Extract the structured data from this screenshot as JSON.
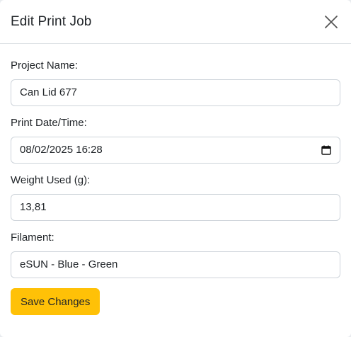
{
  "dialog": {
    "title": "Edit Print Job",
    "close_icon": "close-icon"
  },
  "form": {
    "project_name": {
      "label": "Project Name:",
      "value": "Can Lid 677"
    },
    "print_datetime": {
      "label": "Print Date/Time:",
      "value": "08/02/2025 16:28",
      "icon": "calendar-icon"
    },
    "weight_used": {
      "label": "Weight Used (g):",
      "value": "13,81"
    },
    "filament": {
      "label": "Filament:",
      "value": "eSUN - Blue - Green"
    }
  },
  "actions": {
    "save_label": "Save Changes"
  },
  "colors": {
    "accent": "#ffc107",
    "border": "#ced4da",
    "text": "#212529"
  }
}
